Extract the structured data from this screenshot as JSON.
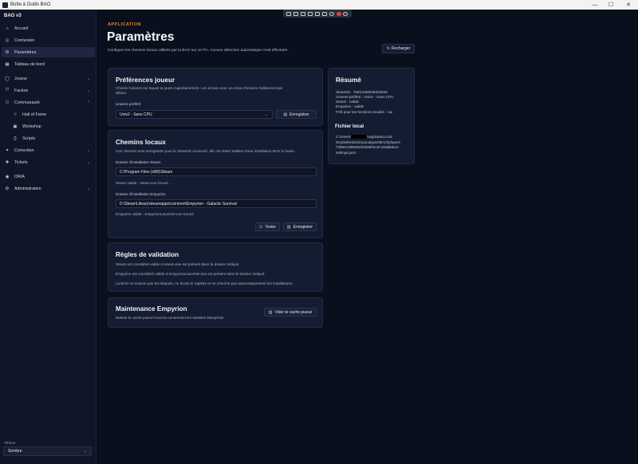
{
  "window": {
    "title": "Boîte à Outils BAO",
    "minimize": "—",
    "maximize": "☐",
    "close": "✕"
  },
  "sidebar": {
    "app_title": "BAO v3",
    "items": [
      {
        "label": "Accueil",
        "icon": "home-icon"
      },
      {
        "label": "Connexion",
        "icon": "user-icon"
      },
      {
        "label": "Paramètres",
        "icon": "gear-icon",
        "active": true
      },
      {
        "label": "Tableau de bord",
        "icon": "dashboard-icon"
      },
      {
        "label": "Joueur",
        "icon": "person-icon"
      },
      {
        "label": "Faction",
        "icon": "shield-icon"
      },
      {
        "label": "Communauté",
        "icon": "community-icon"
      },
      {
        "label": "Hall of Fame",
        "icon": "star-icon"
      },
      {
        "label": "Workshop",
        "icon": "blueprint-icon"
      },
      {
        "label": "Scripts",
        "icon": "code-icon"
      },
      {
        "label": "Correction",
        "icon": "sparkle-icon"
      },
      {
        "label": "Tickets",
        "icon": "ticket-icon"
      },
      {
        "label": "ORIA",
        "icon": "oria-icon"
      },
      {
        "label": "Administration",
        "icon": "admin-gear-icon"
      }
    ],
    "theme_label": "Thème",
    "theme_value": "Sombre"
  },
  "header": {
    "kicker": "APPLICATION",
    "title": "Paramètres",
    "subtitle": "Configure les chemins locaux utilisés par la BAO sur ce PC. Aucune détection automatique n'est effectuée.",
    "reload_label": "Recharger"
  },
  "prefs": {
    "title": "Préférences joueur",
    "description_line1": "Choisis l'univers sur lequel tu joues majoritairement. Les écrans avec un choix d'univers l'utiliseront par",
    "description_line2": "défaut.",
    "universe_label": "Univers préféré",
    "universe_value": "Univ2 - Sans CPU",
    "save_label": "Enregistrer"
  },
  "paths": {
    "title": "Chemins locaux",
    "description": "Ces chemins sont enregistrés pour le SteamID connecté, afin de rester stables d'une installation BAO à l'autre.",
    "steam_label": "Dossier d'installation Steam",
    "steam_value": "C:\\Program Files (x86)\\Steam",
    "steam_status": "Steam valide : steam.exe trouvé.",
    "empyrion_label": "Dossier d'installation Empyrion",
    "empyrion_value": "D:\\SteamLibrary\\steamapps\\common\\Empyrion - Galactic Survival",
    "empyrion_status": "Empyrion valide : EmpyrionLauncher.exe trouvé.",
    "test_label": "Tester",
    "save_label": "Enregistrer"
  },
  "rules": {
    "title": "Règles de validation",
    "line1": "Steam est considéré valide si steam.exe est présent dans le dossier indiqué.",
    "line2": "Empyrion est considéré valide si EmpyrionLauncher.exe est présent dans le dossier indiqué.",
    "line3": "La BAO ne scanne pas tes disques, ne lit pas le registre et ne cherche pas automatiquement les installations."
  },
  "maintenance": {
    "title": "Maintenance Empyrion",
    "description": "Nettoie le cache joueur local en conservant les dossiers Blueprints.",
    "clear_label": "Vider le cache joueur"
  },
  "summary": {
    "title": "Résumé",
    "steamid": "SteamID : 76561198049403259",
    "universe": "Univers préféré : Univ2 - Sans CPU",
    "steam": "Steam : valide",
    "empyrion": "Empyrion : valide",
    "ready": "Prêt pour les fonctions locales : oui",
    "file_title": "Fichier local",
    "file_line1_a": "C:\\Users\\",
    "file_line1_b": "\\AppData\\Local",
    "file_line2": "\\DrybellresDai\\Apocalypse\\BAO\\players",
    "file_line3": "\\76561198049403259\\local-installation-",
    "file_line4": "settings.json"
  },
  "colors": {
    "accent": "#e8853a",
    "background": "#0a0f1e",
    "card": "#141c31",
    "sidebar": "#101627",
    "active_item": "#1f2740"
  }
}
